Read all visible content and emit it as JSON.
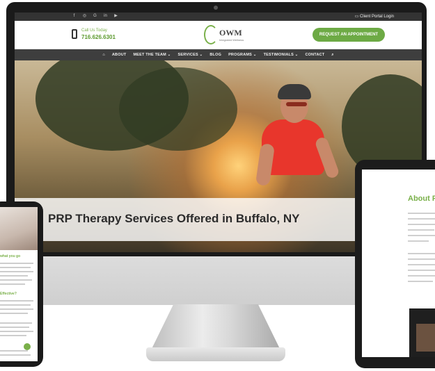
{
  "site": {
    "topbar": {
      "social_icons": [
        "facebook-icon",
        "instagram-icon",
        "google-icon",
        "linkedin-icon",
        "youtube-icon"
      ],
      "client_portal": "Client Portal Login"
    },
    "header": {
      "call_label": "Call Us Today",
      "phone_number": "716.626.6301",
      "logo_text": "OWM",
      "logo_sub": "Integrated Wellness",
      "appointment_button": "REQUEST AN APPOINTMENT"
    },
    "nav": [
      "ABOUT",
      "MEET THE TEAM ⌄",
      "SERVICES ⌄",
      "BLOG",
      "PROGRAMS ⌄",
      "TESTIMONIALS ⌄",
      "CONTACT"
    ],
    "hero": {
      "title": "PRP Therapy Services Offered in Buffalo, NY"
    }
  },
  "tablet": {
    "heading": "About P"
  },
  "phone": {
    "headings": [
      "what you go",
      "Effective?"
    ]
  },
  "colors": {
    "brand_green": "#6daa45",
    "nav_bg": "#3e3e3e",
    "topbar_bg": "#333333"
  }
}
